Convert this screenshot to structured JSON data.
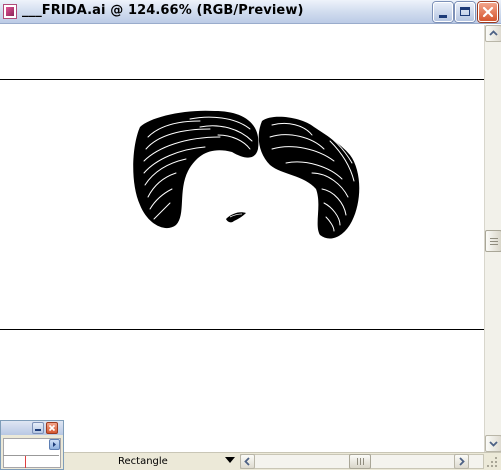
{
  "window": {
    "title": "___FRIDA.ai @ 124.66% (RGB/Preview)",
    "controls": [
      "minimize",
      "maximize",
      "close"
    ]
  },
  "canvas": {
    "artwork": "hair-illustration"
  },
  "status_bar": {
    "tool_label": "Rectangle"
  },
  "colors": {
    "title_bar": "#cfdbee",
    "close_button": "#d5562f",
    "chrome": "#ece9d8",
    "canvas": "#ffffff",
    "artwork": "#000000"
  }
}
